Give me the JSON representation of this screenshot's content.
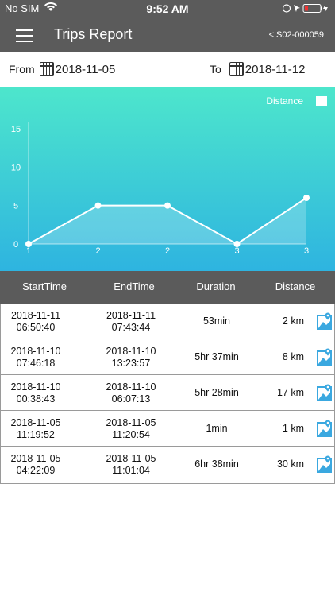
{
  "status": {
    "carrier": "No SIM",
    "time": "9:52 AM"
  },
  "nav": {
    "title": "Trips Report",
    "device": "< S02-000059"
  },
  "dates": {
    "from_label": "From",
    "from_value": "2018-11-05",
    "to_label": "To",
    "to_value": "2018-11-12"
  },
  "chart_data": {
    "type": "area",
    "categories": [
      "1",
      "2",
      "2",
      "3",
      "3"
    ],
    "values": [
      0,
      5,
      5,
      0,
      6
    ],
    "ylim": [
      0,
      15
    ],
    "yticks": [
      "0",
      "5",
      "10",
      "15"
    ],
    "legend": [
      {
        "name": "Distance",
        "color": "#ffffff"
      }
    ],
    "legend_position": "top-right"
  },
  "table": {
    "headers": [
      "StartTime",
      "EndTime",
      "Duration",
      "Distance"
    ],
    "rows": [
      {
        "start_date": "2018-11-11",
        "start_time": "06:50:40",
        "end_date": "2018-11-11",
        "end_time": "07:43:44",
        "duration": "53min",
        "distance": "2 km"
      },
      {
        "start_date": "2018-11-10",
        "start_time": "07:46:18",
        "end_date": "2018-11-10",
        "end_time": "13:23:57",
        "duration": "5hr 37min",
        "distance": "8 km"
      },
      {
        "start_date": "2018-11-10",
        "start_time": "00:38:43",
        "end_date": "2018-11-10",
        "end_time": "06:07:13",
        "duration": "5hr 28min",
        "distance": "17 km"
      },
      {
        "start_date": "2018-11-05",
        "start_time": "11:19:52",
        "end_date": "2018-11-05",
        "end_time": "11:20:54",
        "duration": "1min",
        "distance": "1 km"
      },
      {
        "start_date": "2018-11-05",
        "start_time": "04:22:09",
        "end_date": "2018-11-05",
        "end_time": "11:01:04",
        "duration": "6hr 38min",
        "distance": "30 km"
      }
    ]
  },
  "colors": {
    "bar": "#5b5b5b",
    "chart_top": "#4de6cc",
    "chart_bottom": "#2eb4e0",
    "icon": "#3aa8e0"
  }
}
